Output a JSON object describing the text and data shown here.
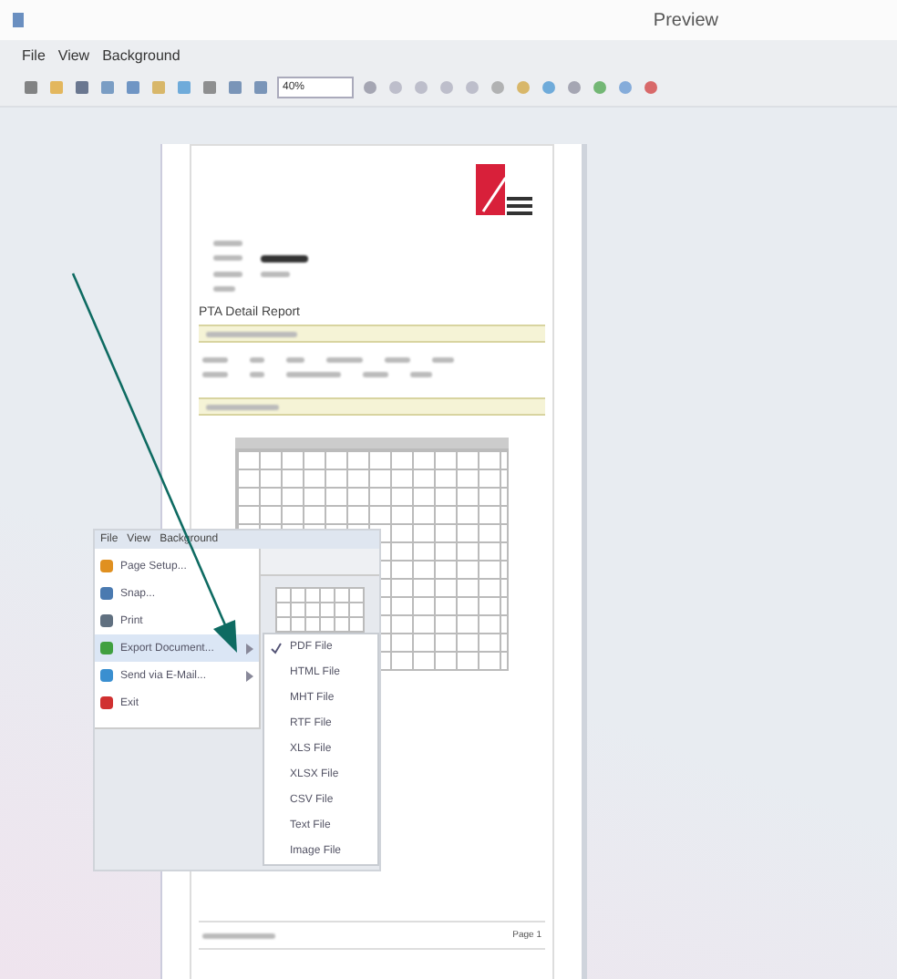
{
  "window": {
    "title": "Preview"
  },
  "menu_bar": [
    "File",
    "View",
    "Background"
  ],
  "toolbar": {
    "zoom": "40%"
  },
  "report": {
    "title": "PTA Detail Report",
    "page_label": "Page 1"
  },
  "inset": {
    "menu_bar": [
      "File",
      "View",
      "Background"
    ],
    "menu_items": [
      {
        "label": "Page Setup...",
        "selected": false,
        "submenu": false
      },
      {
        "label": "Snap...",
        "selected": false,
        "submenu": false
      },
      {
        "label": "Print",
        "selected": false,
        "submenu": false
      },
      {
        "label": "Export Document...",
        "selected": true,
        "submenu": true
      },
      {
        "label": "Send via E-Mail...",
        "selected": false,
        "submenu": true
      },
      {
        "label": "Exit",
        "selected": false,
        "submenu": false
      }
    ],
    "submenu_items": [
      {
        "label": "PDF File",
        "checked": true
      },
      {
        "label": "HTML File",
        "checked": false
      },
      {
        "label": "MHT File",
        "checked": false
      },
      {
        "label": "RTF File",
        "checked": false
      },
      {
        "label": "XLS File",
        "checked": false
      },
      {
        "label": "XLSX File",
        "checked": false
      },
      {
        "label": "CSV File",
        "checked": false
      },
      {
        "label": "Text File",
        "checked": false
      },
      {
        "label": "Image File",
        "checked": false
      }
    ]
  }
}
